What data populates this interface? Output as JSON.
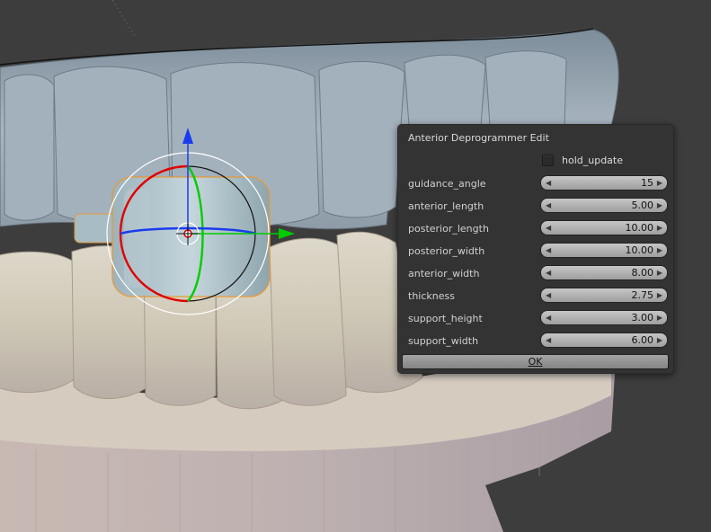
{
  "dialog": {
    "title": "Anterior Deprogrammer Edit",
    "hold_update": {
      "label": "hold_update",
      "checked": false
    },
    "fields": [
      {
        "label": "guidance_angle",
        "value": "15"
      },
      {
        "label": "anterior_length",
        "value": "5.00"
      },
      {
        "label": "posterior_length",
        "value": "10.00"
      },
      {
        "label": "posterior_width",
        "value": "10.00"
      },
      {
        "label": "anterior_width",
        "value": "8.00"
      },
      {
        "label": "thickness",
        "value": "2.75"
      },
      {
        "label": "support_height",
        "value": "3.00"
      },
      {
        "label": "support_width",
        "value": "6.00"
      }
    ],
    "ok_label": "OK"
  },
  "colors": {
    "viewport_bg": "#3d3d3d",
    "panel_bg": "#333333",
    "x_axis": "#e00000",
    "y_axis": "#00cc00",
    "z_axis": "#1a3cf0"
  }
}
